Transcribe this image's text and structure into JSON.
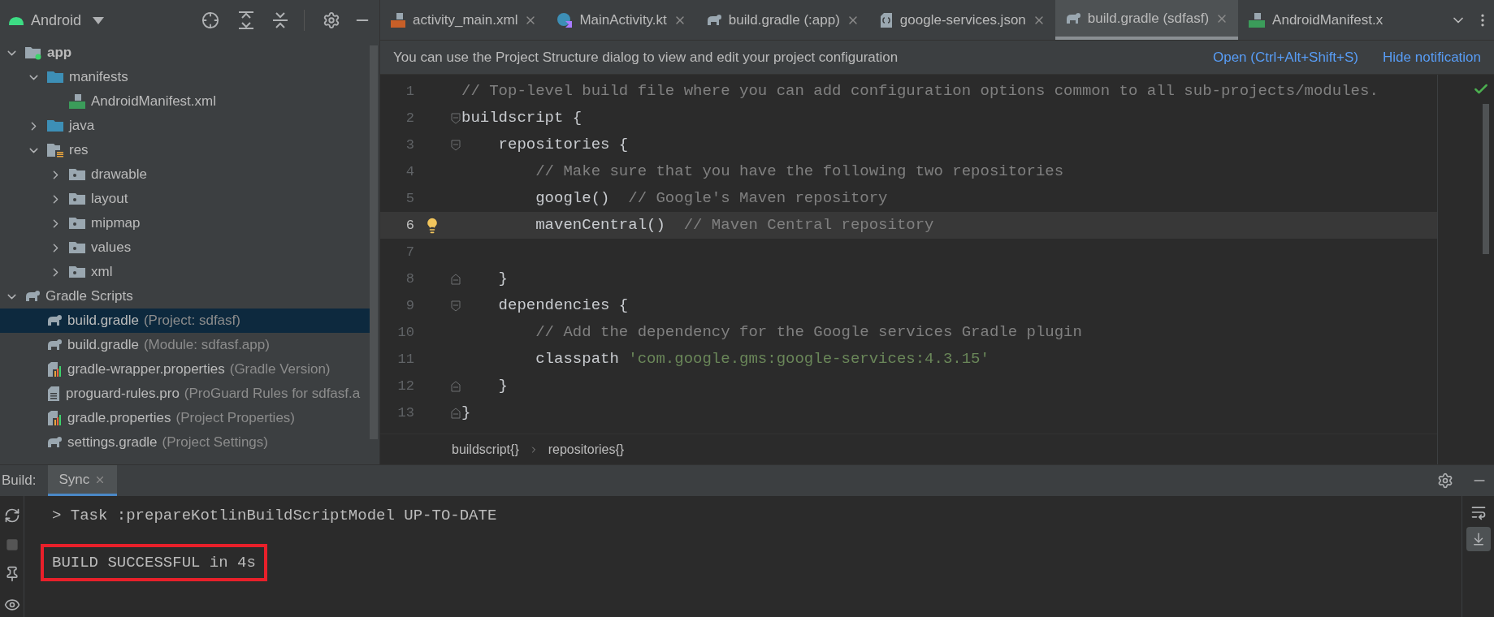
{
  "project_panel": {
    "view": "Android",
    "tree": [
      {
        "label": "app",
        "kind": "module",
        "expanded": true,
        "selected": false,
        "children": [
          {
            "label": "manifests",
            "kind": "folder",
            "expanded": true,
            "selected": false,
            "children": [
              {
                "label": "AndroidManifest.xml",
                "kind": "manifest",
                "selected": false
              }
            ]
          },
          {
            "label": "java",
            "kind": "folder",
            "expanded": false,
            "selected": false
          },
          {
            "label": "res",
            "kind": "res",
            "expanded": true,
            "selected": false,
            "children": [
              {
                "label": "drawable",
                "kind": "resdir",
                "expanded": false,
                "selected": false
              },
              {
                "label": "layout",
                "kind": "resdir",
                "expanded": false,
                "selected": false
              },
              {
                "label": "mipmap",
                "kind": "resdir",
                "expanded": false,
                "selected": false
              },
              {
                "label": "values",
                "kind": "resdir",
                "expanded": false,
                "selected": false
              },
              {
                "label": "xml",
                "kind": "resdir",
                "expanded": false,
                "selected": false
              }
            ]
          }
        ]
      },
      {
        "label": "Gradle Scripts",
        "kind": "gradle",
        "expanded": true,
        "selected": false,
        "children": [
          {
            "label": "build.gradle",
            "hint": "(Project: sdfasf)",
            "kind": "gradle",
            "selected": true
          },
          {
            "label": "build.gradle",
            "hint": "(Module: sdfasf.app)",
            "kind": "gradle",
            "selected": false
          },
          {
            "label": "gradle-wrapper.properties",
            "hint": "(Gradle Version)",
            "kind": "properties",
            "selected": false
          },
          {
            "label": "proguard-rules.pro",
            "hint": "(ProGuard Rules for sdfasf.a",
            "kind": "text",
            "selected": false
          },
          {
            "label": "gradle.properties",
            "hint": "(Project Properties)",
            "kind": "properties",
            "selected": false
          },
          {
            "label": "settings.gradle",
            "hint": "(Project Settings)",
            "kind": "gradle",
            "selected": false
          }
        ]
      }
    ]
  },
  "tabs": [
    {
      "label": "activity_main.xml",
      "kind": "xml",
      "selected": false
    },
    {
      "label": "MainActivity.kt",
      "kind": "kotlin",
      "selected": false
    },
    {
      "label": "build.gradle (:app)",
      "kind": "gradle",
      "selected": false
    },
    {
      "label": "google-services.json",
      "kind": "json",
      "selected": false
    },
    {
      "label": "build.gradle (sdfasf)",
      "kind": "gradle",
      "selected": true
    },
    {
      "label": "AndroidManifest.x",
      "kind": "manifest",
      "selected": false
    }
  ],
  "notification": {
    "text": "You can use the Project Structure dialog to view and edit your project configuration",
    "actions": [
      "Open (Ctrl+Alt+Shift+S)",
      "Hide notification"
    ]
  },
  "editor": {
    "lines": [
      {
        "number": "1",
        "kind": "plain",
        "current": false,
        "segments": [
          {
            "kind": "comment",
            "text": "// Top-level build file where you can add configuration options common to all sub-projects/modules."
          }
        ]
      },
      {
        "number": "2",
        "kind": "fold_start",
        "current": false,
        "segments": [
          {
            "kind": "code",
            "text": "buildscript {"
          }
        ]
      },
      {
        "number": "3",
        "kind": "fold_start",
        "current": false,
        "segments": [
          {
            "kind": "code",
            "text": "    repositories {"
          }
        ]
      },
      {
        "number": "4",
        "kind": "plain",
        "current": false,
        "segments": [
          {
            "kind": "comment",
            "text": "        // Make sure that you have the following two repositories"
          }
        ]
      },
      {
        "number": "5",
        "kind": "plain",
        "current": false,
        "segments": [
          {
            "kind": "code",
            "text": "        google()  "
          },
          {
            "kind": "comment",
            "text": "// Google's Maven repository"
          }
        ]
      },
      {
        "number": "6",
        "kind": "plain",
        "current": true,
        "bulb": true,
        "segments": [
          {
            "kind": "code",
            "text": "        mavenCentral()  "
          },
          {
            "kind": "comment",
            "text": "// Maven Central repository"
          }
        ]
      },
      {
        "number": "7",
        "kind": "plain",
        "current": false
      },
      {
        "number": "8",
        "kind": "fold_end",
        "current": false,
        "segments": [
          {
            "kind": "code",
            "text": "    }"
          }
        ]
      },
      {
        "number": "9",
        "kind": "fold_start",
        "current": false,
        "segments": [
          {
            "kind": "code",
            "text": "    dependencies {"
          }
        ]
      },
      {
        "number": "10",
        "kind": "plain",
        "current": false,
        "segments": [
          {
            "kind": "comment",
            "text": "        // Add the dependency for the Google services Gradle plugin"
          }
        ]
      },
      {
        "number": "11",
        "kind": "plain",
        "current": false,
        "segments": [
          {
            "kind": "code",
            "text": "        classpath "
          },
          {
            "kind": "string",
            "text": "'com.google.gms:google-services:4.3.15'"
          }
        ]
      },
      {
        "number": "12",
        "kind": "fold_end",
        "current": false,
        "segments": [
          {
            "kind": "code",
            "text": "    }"
          }
        ]
      },
      {
        "number": "13",
        "kind": "fold_end",
        "current": false,
        "segments": [
          {
            "kind": "code",
            "text": "}"
          }
        ]
      }
    ],
    "breadcrumbs": [
      "buildscript{}",
      "repositories{}"
    ]
  },
  "build_panel": {
    "label": "Build:",
    "tabs": [
      {
        "label": "Sync",
        "selected": true
      }
    ],
    "console": [
      {
        "text": "> Task :prepareKotlinBuildScriptModel UP-TO-DATE",
        "highlighted": false
      },
      {
        "text": "BUILD SUCCESSFUL in 4s",
        "highlighted": true
      }
    ]
  }
}
